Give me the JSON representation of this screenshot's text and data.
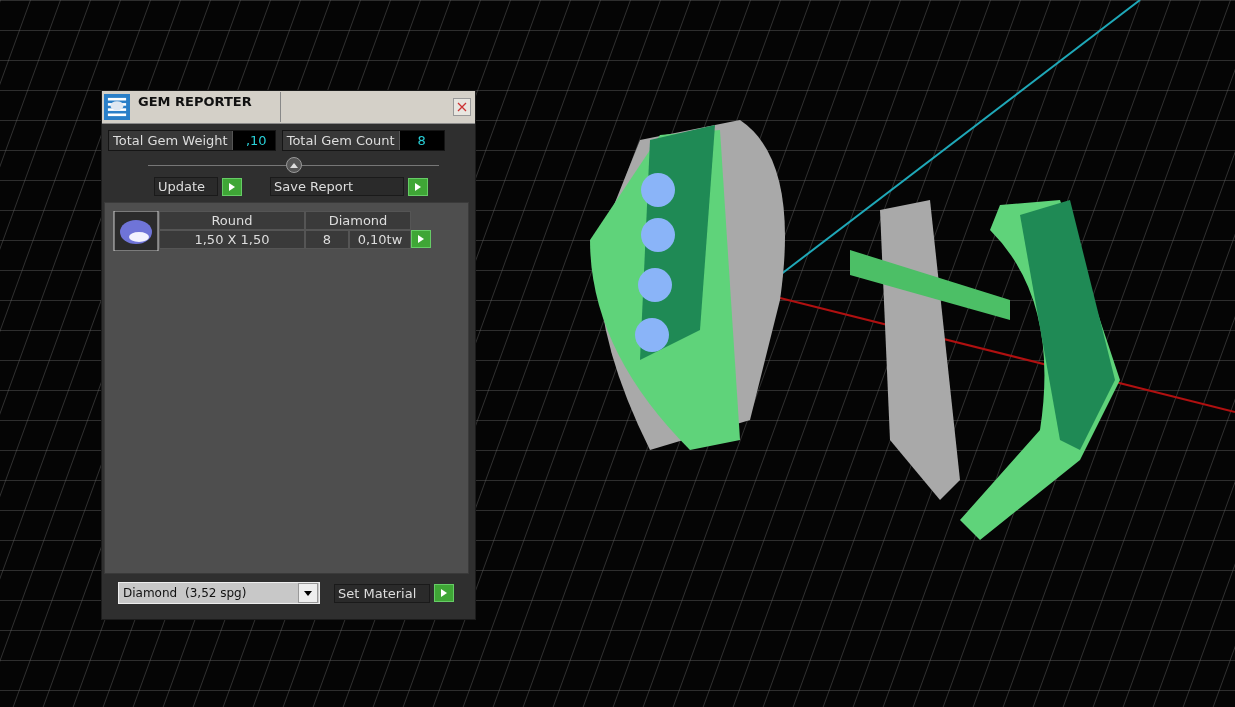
{
  "window": {
    "title": "GEM REPORTER"
  },
  "totals": [
    {
      "label": "Total Gem Weight",
      "value": ",10"
    },
    {
      "label": "Total Gem Count",
      "value": "8"
    }
  ],
  "actions": [
    {
      "label": "Update"
    },
    {
      "label": "Save Report"
    }
  ],
  "gems": [
    {
      "shape": "Round",
      "material": "Diamond",
      "size": "1,50 X 1,50",
      "count": "8",
      "weight": "0,10tw"
    }
  ],
  "material_select": {
    "value": "Diamond",
    "density": "(3,52 spg)"
  },
  "set_material": {
    "label": "Set Material"
  }
}
